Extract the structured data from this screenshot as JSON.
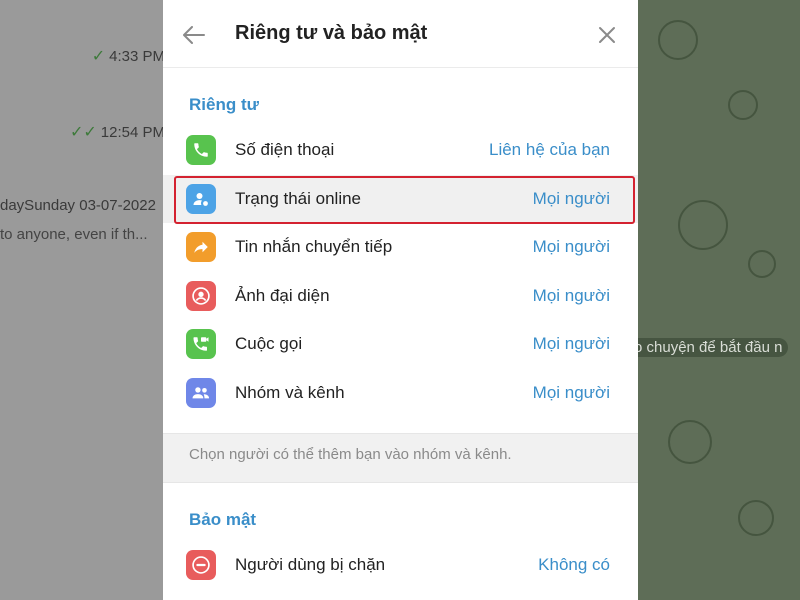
{
  "background_left": {
    "time1": "4:33 PM",
    "time2": "12:54 PM",
    "date_text": "daySunday 03-07-2022",
    "preview_text": "to anyone, even if th..."
  },
  "background_right": {
    "hint_text": "o chuyện để bắt đầu n"
  },
  "dialog": {
    "title": "Riêng tư và bảo mật",
    "privacy_section": {
      "title": "Riêng tư",
      "items": [
        {
          "label": "Số điện thoại",
          "value": "Liên hệ của bạn",
          "icon": "phone-icon",
          "color": "#58c34e"
        },
        {
          "label": "Trạng thái online",
          "value": "Mọi người",
          "icon": "user-status-icon",
          "color": "#4da3e6"
        },
        {
          "label": "Tin nhắn chuyển tiếp",
          "value": "Mọi người",
          "icon": "forward-icon",
          "color": "#f29d2b"
        },
        {
          "label": "Ảnh đại diện",
          "value": "Mọi người",
          "icon": "avatar-icon",
          "color": "#e85c5c"
        },
        {
          "label": "Cuộc gọi",
          "value": "Mọi người",
          "icon": "video-call-icon",
          "color": "#58c34e"
        },
        {
          "label": "Nhóm và kênh",
          "value": "Mọi người",
          "icon": "group-icon",
          "color": "#6f87e8"
        }
      ],
      "note": "Chọn người có thể thêm bạn vào nhóm và kênh."
    },
    "security_section": {
      "title": "Bảo mật",
      "items": [
        {
          "label": "Người dùng bị chặn",
          "value": "Không có",
          "icon": "block-icon",
          "color": "#e85c5c"
        }
      ]
    }
  },
  "colors": {
    "accent": "#3a8ec9",
    "highlight_border": "#d42230"
  }
}
